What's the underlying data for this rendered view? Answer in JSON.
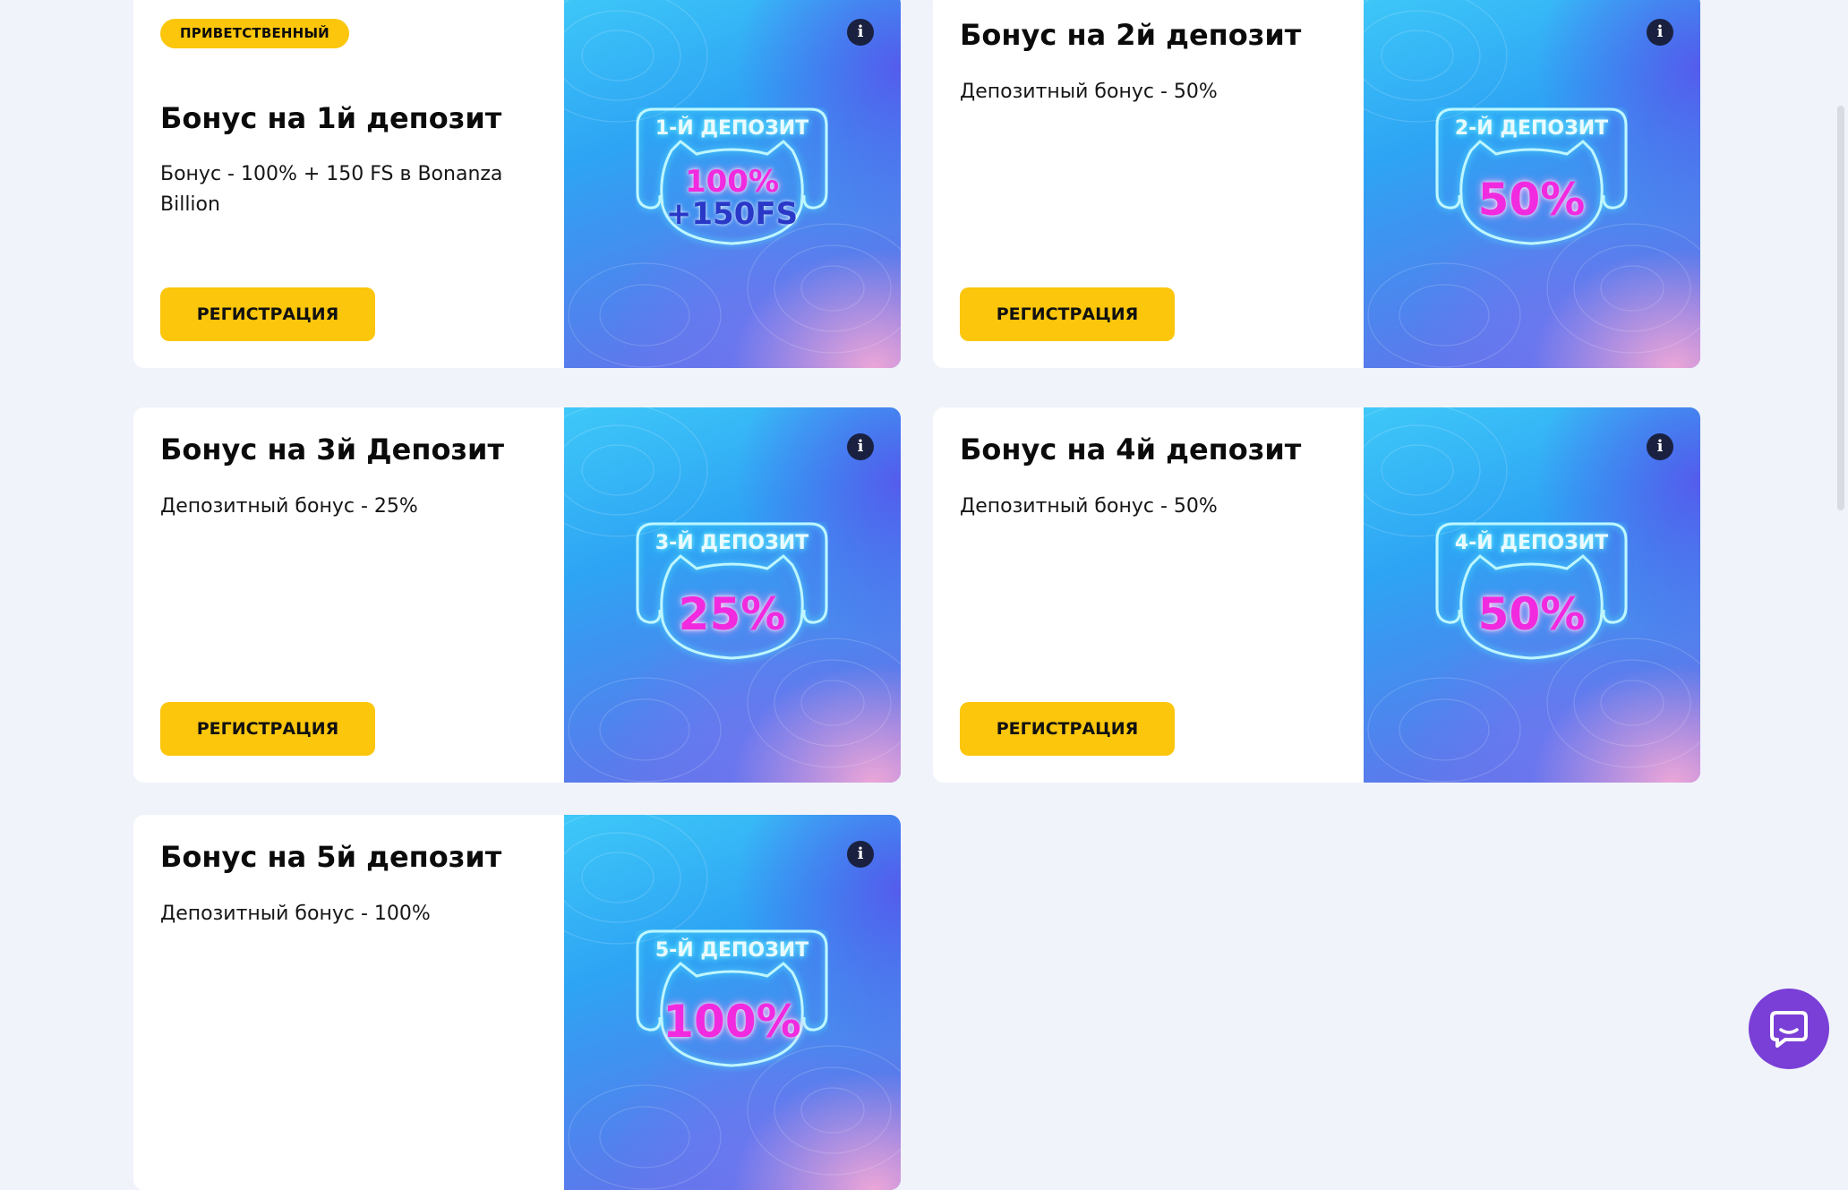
{
  "cards": [
    {
      "badge": "ПРИВЕТСТВЕННЫЙ",
      "title": "Бонус на 1й депозит",
      "description": "Бонус - 100% + 150 FS в Bonanza Billion",
      "button_label": "РЕГИСТРАЦИЯ",
      "emblem_label": "1-Й ДЕПОЗИТ",
      "emblem_value": "100%",
      "emblem_value_line2": "+150FS"
    },
    {
      "title": "Бонус на 2й депозит",
      "description": "Депозитный бонус - 50%",
      "button_label": "РЕГИСТРАЦИЯ",
      "emblem_label": "2-Й ДЕПОЗИТ",
      "emblem_value": "50%"
    },
    {
      "title": "Бонус на 3й Депозит",
      "description": "Депозитный бонус - 25%",
      "button_label": "РЕГИСТРАЦИЯ",
      "emblem_label": "3-Й ДЕПОЗИТ",
      "emblem_value": "25%"
    },
    {
      "title": "Бонус на 4й депозит",
      "description": "Депозитный бонус - 50%",
      "button_label": "РЕГИСТРАЦИЯ",
      "emblem_label": "4-Й ДЕПОЗИТ",
      "emblem_value": "50%"
    },
    {
      "title": "Бонус на 5й депозит",
      "description": "Депозитный бонус - 100%",
      "emblem_label": "5-Й ДЕПОЗИТ",
      "emblem_value": "100%"
    }
  ],
  "icons": {
    "info": "info-icon",
    "chat": "chat-bubble-icon"
  },
  "colors": {
    "accent_yellow": "#fbc60b",
    "chat_purple": "#7a3fd6",
    "page_background": "#f0f3fa",
    "emblem_value": "#f12adf"
  }
}
